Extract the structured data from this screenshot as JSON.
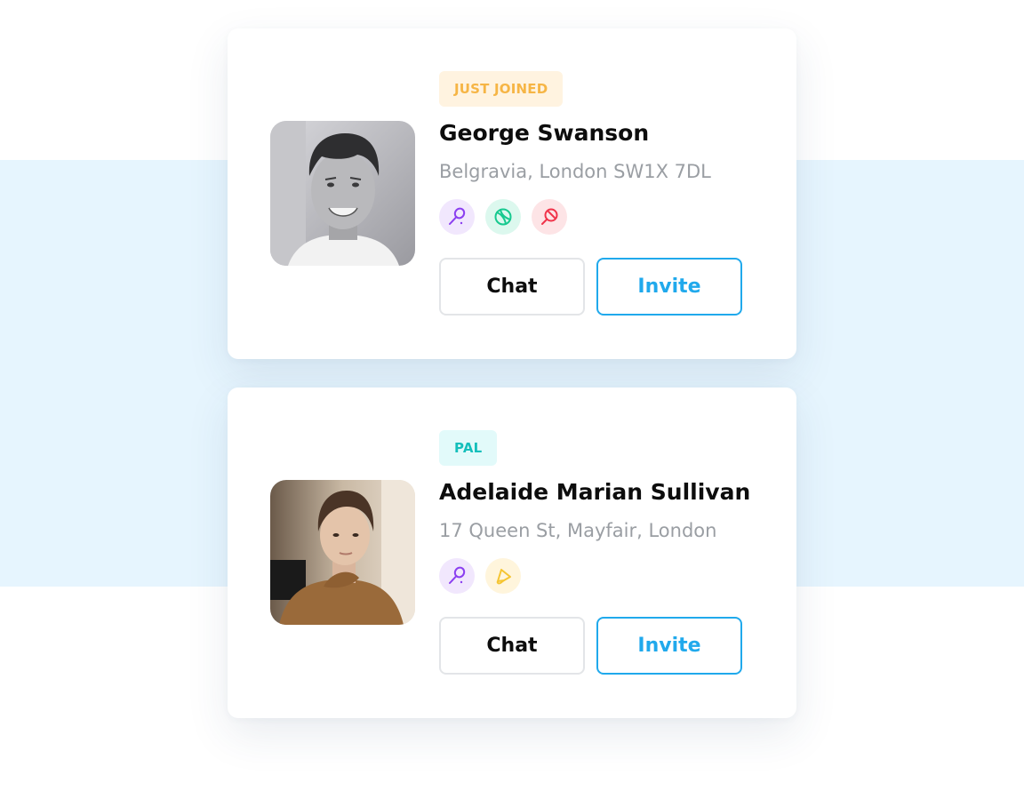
{
  "profiles": [
    {
      "badge": "JUST JOINED",
      "name": "George Swanson",
      "address": "Belgravia, London SW1X 7DL",
      "sports": [
        "badminton-racket-icon",
        "tennis-ball-icon",
        "ping-pong-paddle-icon"
      ],
      "chat_label": "Chat",
      "invite_label": "Invite"
    },
    {
      "badge": "PAL",
      "name": "Adelaide Marian Sullivan",
      "address": "17 Queen St, Mayfair, London",
      "sports": [
        "badminton-racket-icon",
        "shuttlecock-icon"
      ],
      "chat_label": "Chat",
      "invite_label": "Invite"
    }
  ],
  "colors": {
    "accent": "#20a9ec",
    "band": "#e6f5fe",
    "badge_joined_text": "#f6b545",
    "badge_pal_text": "#14bfbb",
    "sport_purple": "#8b3ff0",
    "sport_green": "#16c98f",
    "sport_red": "#f0334a",
    "sport_yellow": "#f5c533"
  }
}
